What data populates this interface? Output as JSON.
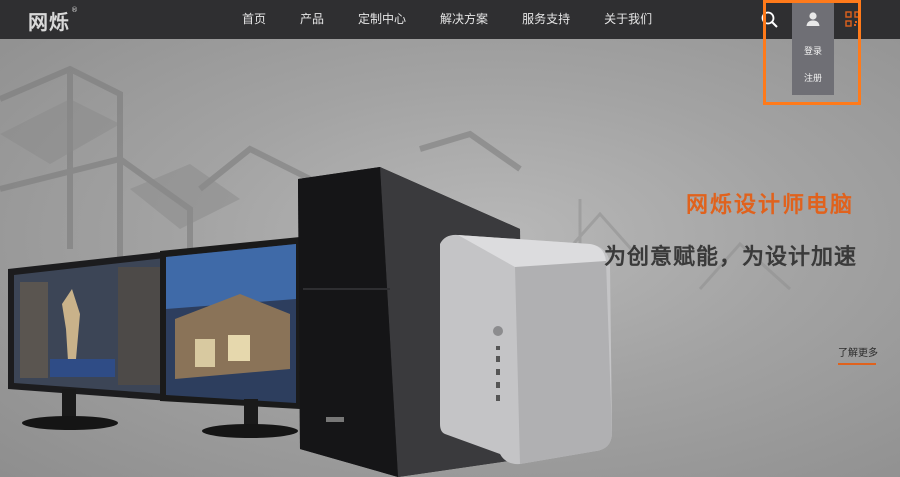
{
  "header": {
    "logo_text": "网烁",
    "logo_mark": "®",
    "nav": [
      "首页",
      "产品",
      "定制中心",
      "解决方案",
      "服务支持",
      "关于我们"
    ]
  },
  "user_menu": {
    "items": [
      "登录",
      "注册"
    ]
  },
  "hero": {
    "title": "网烁设计师电脑",
    "subtitle": "为创意赋能，为设计加速",
    "more_link": "了解更多"
  },
  "colors": {
    "accent": "#e0621d",
    "topbar": "#2f2f31",
    "menu_bg": "#6f6f75",
    "highlight": "#ff7a1a"
  }
}
